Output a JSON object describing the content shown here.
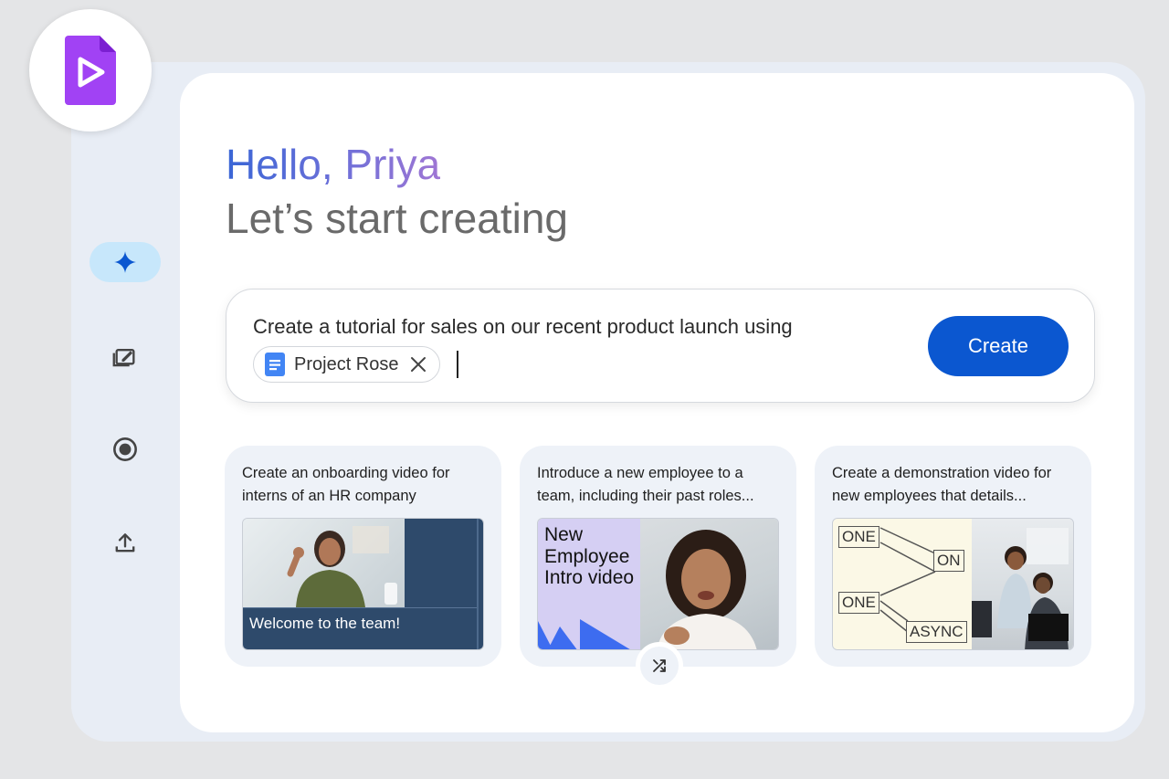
{
  "greeting": {
    "title": "Hello, Priya",
    "subtitle": "Let’s start creating"
  },
  "sidebar": {
    "items": [
      {
        "icon": "sparkle-icon",
        "active": true
      },
      {
        "icon": "media-edit-icon",
        "active": false
      },
      {
        "icon": "record-icon",
        "active": false
      },
      {
        "icon": "upload-icon",
        "active": false
      }
    ]
  },
  "prompt": {
    "text": "Create a tutorial for sales on our recent product launch using",
    "chip": {
      "label": "Project Rose",
      "icon": "docs-icon"
    },
    "create_label": "Create"
  },
  "suggestions": [
    {
      "text": "Create an onboarding video for interns of an HR company",
      "thumb_caption": "Welcome to the team!"
    },
    {
      "text": "Introduce a new employee to a team, including their past roles...",
      "thumb_title": "New Employee Intro video"
    },
    {
      "text": "Create a demonstration video for new employees that details...",
      "thumb_labels": [
        "ONE",
        "ON",
        "ONE",
        "ASYNC"
      ]
    }
  ],
  "colors": {
    "accent": "#0b57d0",
    "active_nav": "#c7e7fb",
    "app_icon": "#a142f4",
    "docs_blue": "#4285f4"
  }
}
